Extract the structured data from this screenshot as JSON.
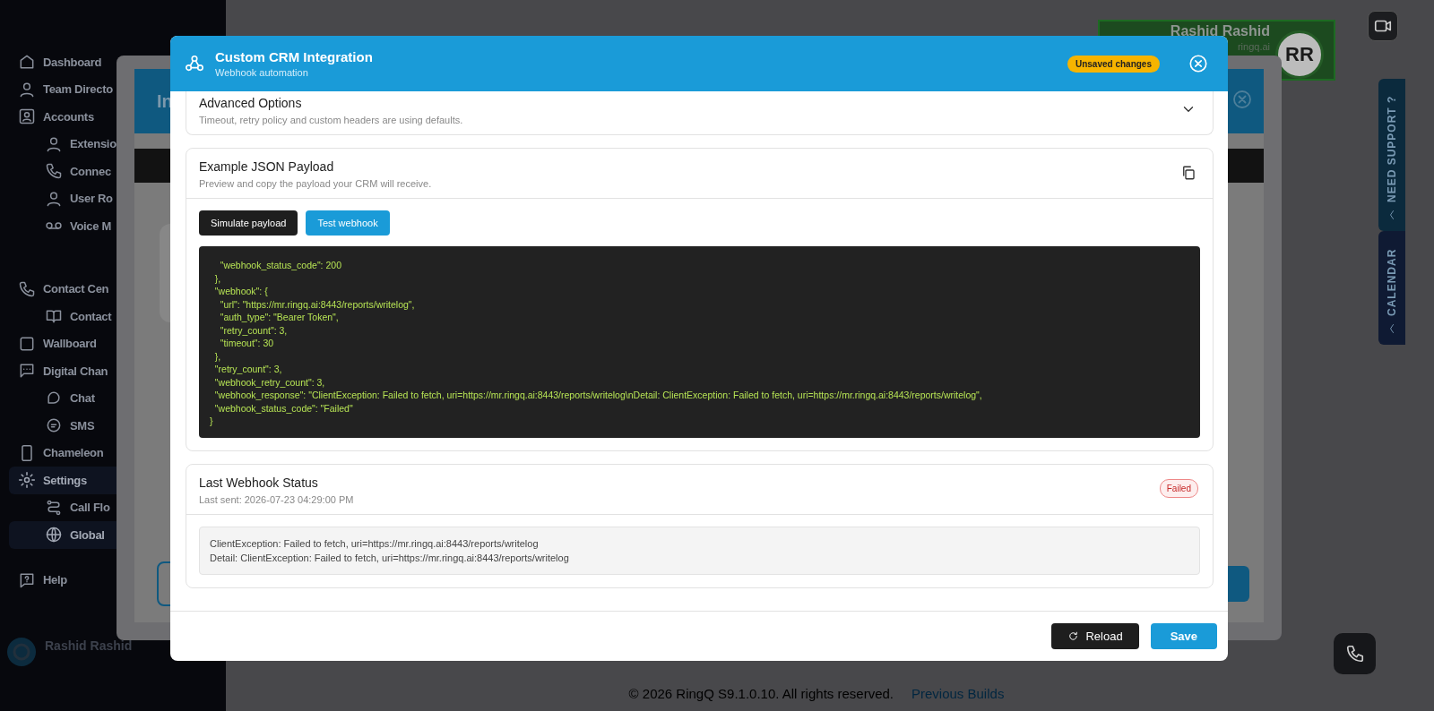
{
  "sidebar": {
    "sections": [
      {
        "items": [
          {
            "label": "Dashboard",
            "selected": false
          },
          {
            "label": "Team Directo",
            "selected": false
          },
          {
            "label": "Accounts",
            "selected": false,
            "children": [
              {
                "label": "Extensio",
                "selected": false
              },
              {
                "label": "Connec",
                "selected": false
              },
              {
                "label": "User Ro",
                "selected": false
              },
              {
                "label": "Voice M",
                "selected": false
              }
            ]
          }
        ]
      },
      {
        "items": [
          {
            "label": "Contact Cen",
            "selected": false,
            "children": [
              {
                "label": "Contact",
                "selected": false
              }
            ]
          },
          {
            "label": "Wallboard",
            "selected": false
          },
          {
            "label": "Digital Chan",
            "selected": false,
            "children": [
              {
                "label": "Chat",
                "selected": false
              },
              {
                "label": "SMS",
                "selected": false
              }
            ]
          },
          {
            "label": "Chameleon",
            "selected": false
          },
          {
            "label": "Settings",
            "selected": true,
            "children": [
              {
                "label": "Call Flo",
                "selected": false
              },
              {
                "label": "Global",
                "selected": true
              }
            ]
          }
        ]
      },
      {
        "items": [
          {
            "label": "Help",
            "selected": false
          }
        ]
      }
    ],
    "user": {
      "name": "Rashid Rashid"
    }
  },
  "header": {
    "user_name": "Rashid Rashid",
    "user_email": "ringq.ai",
    "avatar_initials": "RR"
  },
  "background_dialog": {
    "title": "In"
  },
  "side_tabs": [
    {
      "label": "NEED SUPPORT ?"
    },
    {
      "label": "CALENDAR"
    }
  ],
  "footer": {
    "copyright": "© 2026 RingQ S9.1.0.10. All rights reserved.",
    "link": "Previous Builds"
  },
  "modal": {
    "title": "Custom CRM Integration",
    "subtitle": "Webhook automation",
    "badge": "Unsaved changes",
    "sections": [
      {
        "kind": "collapsible",
        "title": "Advanced Options",
        "subtitle": "Timeout, retry policy and custom headers are using defaults.",
        "expanded": false
      },
      {
        "kind": "payload",
        "title": "Example JSON Payload",
        "subtitle": "Preview and copy the payload your CRM will receive.",
        "buttons": [
          {
            "label": "Simulate payload",
            "kind": "dark"
          },
          {
            "label": "Test webhook",
            "kind": "primary"
          }
        ],
        "code_lines": [
          "    \"webhook_status_code\": 200",
          "  },",
          "  \"webhook\": {",
          "    \"url\": \"https://mr.ringq.ai:8443/reports/writelog\",",
          "    \"auth_type\": \"Bearer Token\",",
          "    \"retry_count\": 3,",
          "    \"timeout\": 30",
          "  },",
          "  \"retry_count\": 3,",
          "  \"webhook_retry_count\": 3,",
          "  \"webhook_response\": \"ClientException: Failed to fetch, uri=https://mr.ringq.ai:8443/reports/writelog\\nDetail: ClientException: Failed to fetch, uri=https://mr.ringq.ai:8443/reports/writelog\",",
          "  \"webhook_status_code\": \"Failed\"",
          "}"
        ]
      },
      {
        "kind": "status",
        "title": "Last Webhook Status",
        "subtitle": "Last sent: 2026-07-23 04:29:00 PM",
        "status": {
          "label": "Failed",
          "kind": "error"
        },
        "message_lines": [
          "ClientException: Failed to fetch, uri=https://mr.ringq.ai:8443/reports/writelog",
          "Detail: ClientException: Failed to fetch, uri=https://mr.ringq.ai:8443/reports/writelog"
        ]
      }
    ],
    "buttons": [
      {
        "label": "Reload",
        "kind": "dark"
      },
      {
        "label": "Save",
        "kind": "primary"
      }
    ]
  }
}
